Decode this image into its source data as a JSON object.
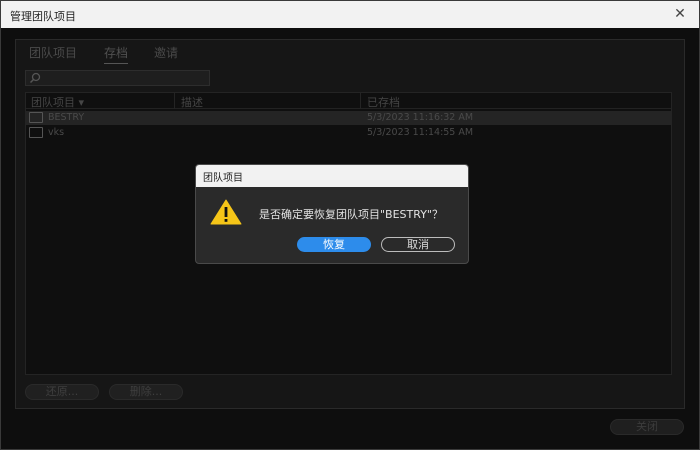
{
  "window": {
    "title": "管理团队项目",
    "close_glyph": "✕"
  },
  "tabs": [
    {
      "label": "团队项目",
      "active": false
    },
    {
      "label": "存档",
      "active": true
    },
    {
      "label": "邀请",
      "active": false
    }
  ],
  "search": {
    "placeholder": ""
  },
  "table": {
    "headers": [
      "团队项目 ▾",
      "描述",
      "已存档"
    ],
    "rows": [
      {
        "name": "BESTRY",
        "description": "",
        "archived": "5/3/2023 11:16:32 AM",
        "selected": true
      },
      {
        "name": "vks",
        "description": "",
        "archived": "5/3/2023 11:14:55 AM",
        "selected": false
      }
    ]
  },
  "bottom_buttons": {
    "restore": "还原...",
    "delete": "删除..."
  },
  "footer": {
    "close_label": "关闭"
  },
  "dialog": {
    "title": "团队项目",
    "message": "是否确定要恢复团队项目\"BESTRY\"？",
    "primary_label": "恢复",
    "secondary_label": "取消",
    "icon": "warning-icon",
    "icon_color": "#f5c518"
  }
}
